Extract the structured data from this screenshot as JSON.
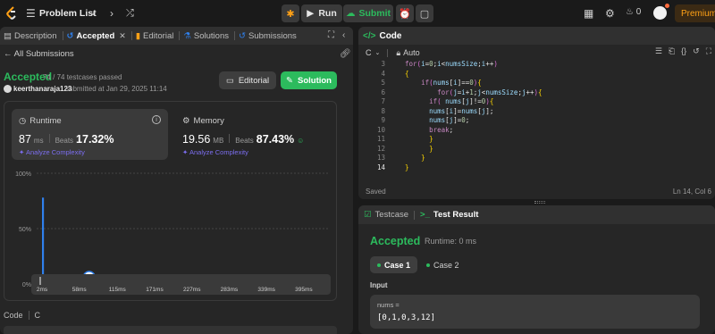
{
  "topbar": {
    "problem_list": "Problem List",
    "run": "Run",
    "submit": "Submit",
    "streak": "0",
    "premium": "Premium"
  },
  "left_tabs": {
    "description": "Description",
    "accepted": "Accepted",
    "editorial": "Editorial",
    "solutions": "Solutions",
    "submissions": "Submissions"
  },
  "submission": {
    "back": "All Submissions",
    "status": "Accepted",
    "passed": "74 / 74 testcases passed",
    "user": "keerthanaraja123",
    "submitted_at": "submitted at Jan 29, 2025 11:14",
    "editorial_btn": "Editorial",
    "solution_btn": "Solution"
  },
  "runtime": {
    "title": "Runtime",
    "value": "87",
    "unit": "ms",
    "beats_label": "Beats",
    "beats": "17.32%",
    "analyze": "Analyze Complexity"
  },
  "memory": {
    "title": "Memory",
    "value": "19.56",
    "unit": "MB",
    "beats_label": "Beats",
    "beats": "87.43%",
    "analyze": "Analyze Complexity"
  },
  "chart_data": {
    "type": "bar",
    "y_ticks": [
      "100%",
      "50%",
      "0%"
    ],
    "ylim": [
      0,
      100
    ],
    "x_ticks": [
      "2ms",
      "58ms",
      "115ms",
      "171ms",
      "227ms",
      "283ms",
      "339ms",
      "395ms"
    ],
    "xlim": [
      2,
      430
    ],
    "values": [
      78,
      1.5,
      1.5,
      1.5,
      1.5,
      1.5,
      1.5,
      1.5,
      1.5,
      1.5,
      1.5,
      1.5,
      1.5,
      1.5,
      1.5,
      1.5,
      1.5,
      1.5,
      1.5,
      1.5,
      1.5,
      1.5,
      1.5,
      1.5,
      1.5,
      1.5,
      1.5,
      1.5,
      1.5,
      1.5,
      1.5,
      1.5,
      1.5,
      1.5,
      1.5,
      1.5,
      1.5,
      1.5,
      1.5,
      1.5,
      1.5,
      1.5,
      1.5,
      1.5,
      1.5,
      1.5,
      1.5,
      1.5,
      1.5,
      1.5,
      1.5,
      1.5,
      1.5,
      1.5,
      1.5,
      1.5,
      1.5,
      1.5,
      1.5,
      1.5,
      1.5,
      1.5,
      1.5,
      1.5,
      1.5,
      1.5,
      1.5,
      1.5,
      1.5,
      1.5,
      1.5,
      1.5,
      1.5,
      1.5,
      1.5,
      1.5,
      1.5,
      1.5,
      1.5,
      1.5,
      1.5
    ],
    "marker_ms": 87,
    "marker_pct": 6,
    "accent": "#2f80ed"
  },
  "code_footer": {
    "label": "Code",
    "lang": "C"
  },
  "code_panel": {
    "title": "Code",
    "lang": "C",
    "mode": "Auto",
    "saved": "Saved",
    "position": "Ln 14, Col 6"
  },
  "code_lines": [
    {
      "n": "3",
      "text": "for(i=0;i<numsSize;i++)"
    },
    {
      "n": "4",
      "text": "{"
    },
    {
      "n": "5",
      "text": "    if(nums[i]==0){"
    },
    {
      "n": "6",
      "text": "        for(j=i+1;j<numsSize;j++){"
    },
    {
      "n": "7",
      "text": "      if( nums[j]!=0){"
    },
    {
      "n": "8",
      "text": "      nums[i]=nums[j];"
    },
    {
      "n": "9",
      "text": "      nums[j]=0;"
    },
    {
      "n": "10",
      "text": "      break;"
    },
    {
      "n": "11",
      "text": "      }"
    },
    {
      "n": "12",
      "text": "      }"
    },
    {
      "n": "13",
      "text": "    }"
    },
    {
      "n": "14",
      "text": "}"
    }
  ],
  "test_panel": {
    "testcase_tab": "Testcase",
    "result_tab": "Test Result",
    "status": "Accepted",
    "runtime": "Runtime: 0 ms",
    "case1": "Case 1",
    "case2": "Case 2",
    "input_label": "Input",
    "input_name": "nums =",
    "input_value": "[0,1,0,3,12]"
  }
}
